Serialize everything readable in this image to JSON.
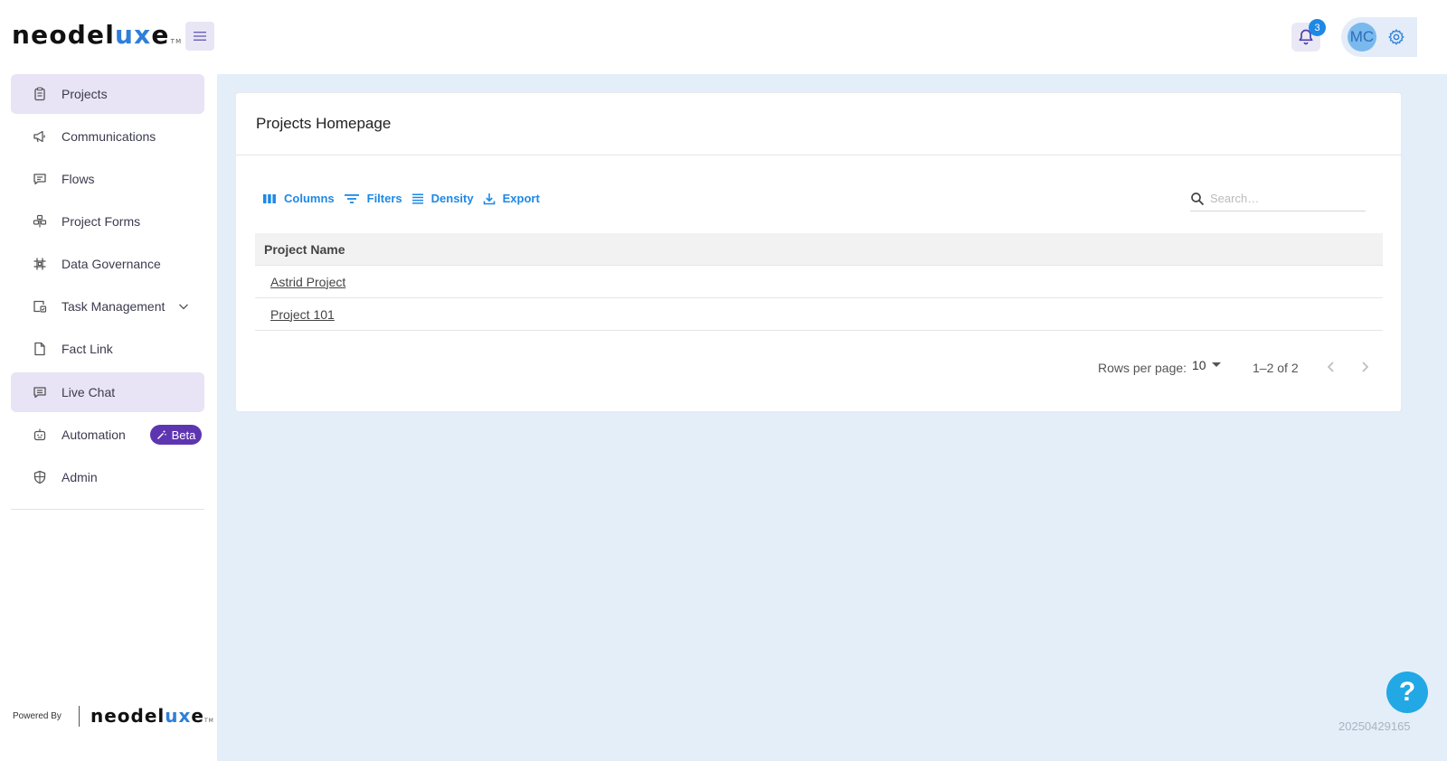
{
  "header": {
    "logo_main": "neodel",
    "logo_accent": "ux",
    "logo_end": "e",
    "logo_tm": "TM",
    "notification_count": "3",
    "avatar_initials": "MC"
  },
  "sidebar": {
    "items": [
      {
        "label": "Projects",
        "icon": "clipboard-icon",
        "active": true
      },
      {
        "label": "Communications",
        "icon": "megaphone-icon"
      },
      {
        "label": "Flows",
        "icon": "message-icon"
      },
      {
        "label": "Project Forms",
        "icon": "form-icon"
      },
      {
        "label": "Data Governance",
        "icon": "grid-hash-icon"
      },
      {
        "label": "Task Management",
        "icon": "task-icon",
        "expandable": true
      },
      {
        "label": "Fact Link",
        "icon": "document-icon"
      },
      {
        "label": "Live Chat",
        "icon": "chat-icon",
        "hovered": true
      },
      {
        "label": "Automation",
        "icon": "robot-icon",
        "badge": "Beta"
      },
      {
        "label": "Admin",
        "icon": "shield-icon"
      }
    ],
    "powered_by": "Powered By"
  },
  "main": {
    "page_title": "Projects Homepage",
    "toolbar": {
      "columns": "Columns",
      "filters": "Filters",
      "density": "Density",
      "export": "Export"
    },
    "search": {
      "placeholder": "Search…",
      "value": ""
    },
    "table": {
      "header": "Project Name",
      "rows": [
        "Astrid Project",
        "Project 101"
      ]
    },
    "pagination": {
      "rows_per_page_label": "Rows per page:",
      "rows_per_page_value": "10",
      "range": "1–2 of 2"
    }
  },
  "footer": {
    "help": "?",
    "build": "20250429165"
  },
  "colors": {
    "accent": "#1e88e5",
    "active_nav": "#e8e3f5",
    "beta_badge": "#5e35b1",
    "main_bg": "#e4eef9"
  }
}
